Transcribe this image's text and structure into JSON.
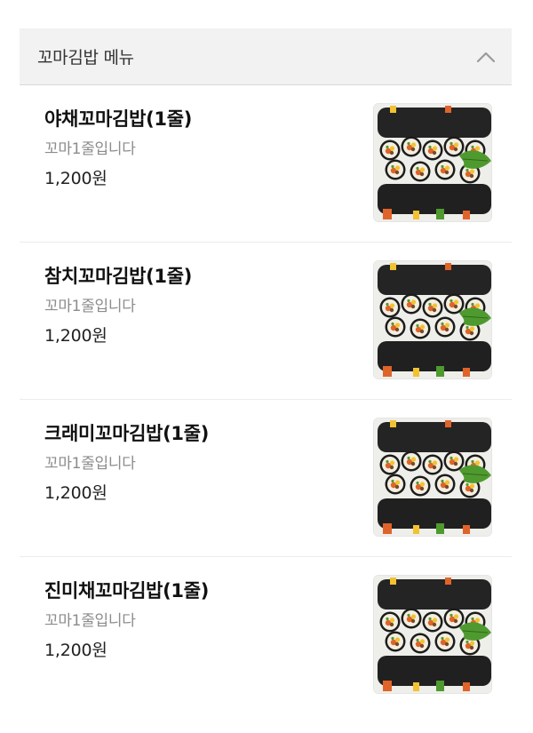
{
  "section": {
    "title": "꼬마김밥 메뉴",
    "expanded_icon": "chevron-up-icon"
  },
  "menu": {
    "items": [
      {
        "name": "야채꼬마김밥(1줄)",
        "description": "꼬마1줄입니다",
        "price": "1,200원",
        "image": "kimbap-photo"
      },
      {
        "name": "참치꼬마김밥(1줄)",
        "description": "꼬마1줄입니다",
        "price": "1,200원",
        "image": "kimbap-photo"
      },
      {
        "name": "크래미꼬마김밥(1줄)",
        "description": "꼬마1줄입니다",
        "price": "1,200원",
        "image": "kimbap-photo"
      },
      {
        "name": "진미채꼬마김밥(1줄)",
        "description": "꼬마1줄입니다",
        "price": "1,200원",
        "image": "kimbap-photo"
      }
    ]
  },
  "colors": {
    "header_bg": "#f2f2f2",
    "desc_gray": "#8c8c8c",
    "seaweed": "#1e1e1e",
    "rice": "#f4efe2",
    "carrot": "#e0642a",
    "greens": "#4f9a2f"
  }
}
